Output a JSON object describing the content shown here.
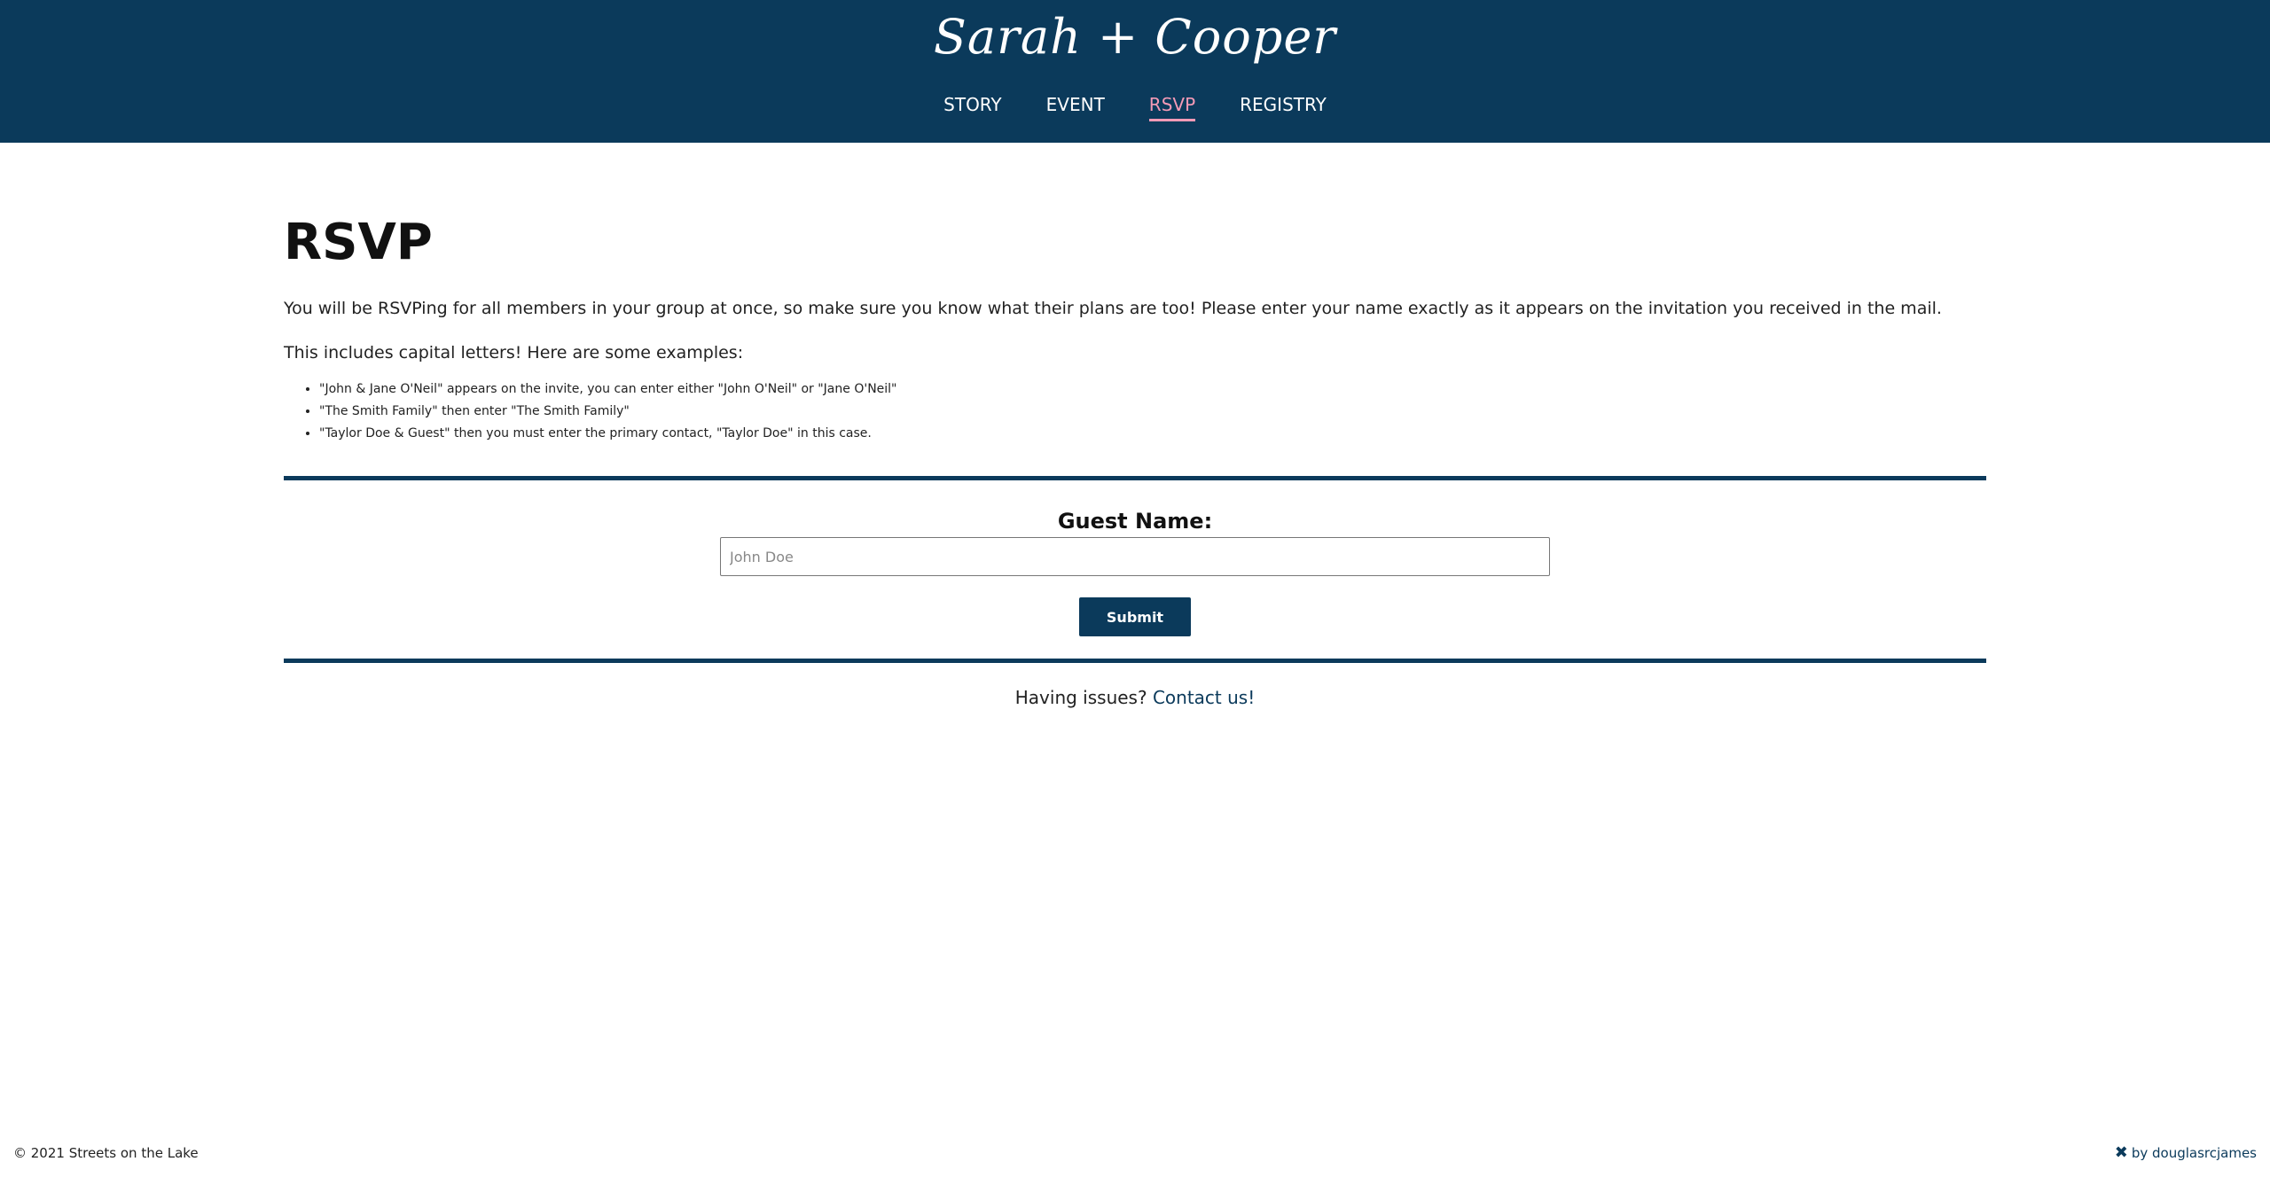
{
  "header": {
    "brand": "Sarah + Cooper",
    "nav": [
      {
        "label": "STORY",
        "active": false
      },
      {
        "label": "EVENT",
        "active": false
      },
      {
        "label": "RSVP",
        "active": true
      },
      {
        "label": "REGISTRY",
        "active": false
      }
    ]
  },
  "main": {
    "title": "RSVP",
    "intro": "You will be RSVPing for all members in your group at once, so make sure you know what their plans are too! Please enter your name exactly as it appears on the invitation you received in the mail.",
    "intro2": "This includes capital letters! Here are some examples:",
    "examples": [
      "\"John & Jane O'Neil\" appears on the invite, you can enter either \"John O'Neil\" or \"Jane O'Neil\"",
      "\"The Smith Family\" then enter \"The Smith Family\"",
      "\"Taylor Doe & Guest\" then you must enter the primary contact, \"Taylor Doe\" in this case."
    ]
  },
  "form": {
    "label": "Guest Name:",
    "placeholder": "John Doe",
    "value": "",
    "submit_label": "Submit"
  },
  "help": {
    "text": "Having issues?",
    "link": "Contact us!"
  },
  "footer": {
    "copyright": "© 2021 Streets on the Lake",
    "credit_icon": "tools-icon",
    "credit": "by douglasrcjames"
  },
  "colors": {
    "primary": "#0b3a5b",
    "accent": "#f49ab6"
  }
}
